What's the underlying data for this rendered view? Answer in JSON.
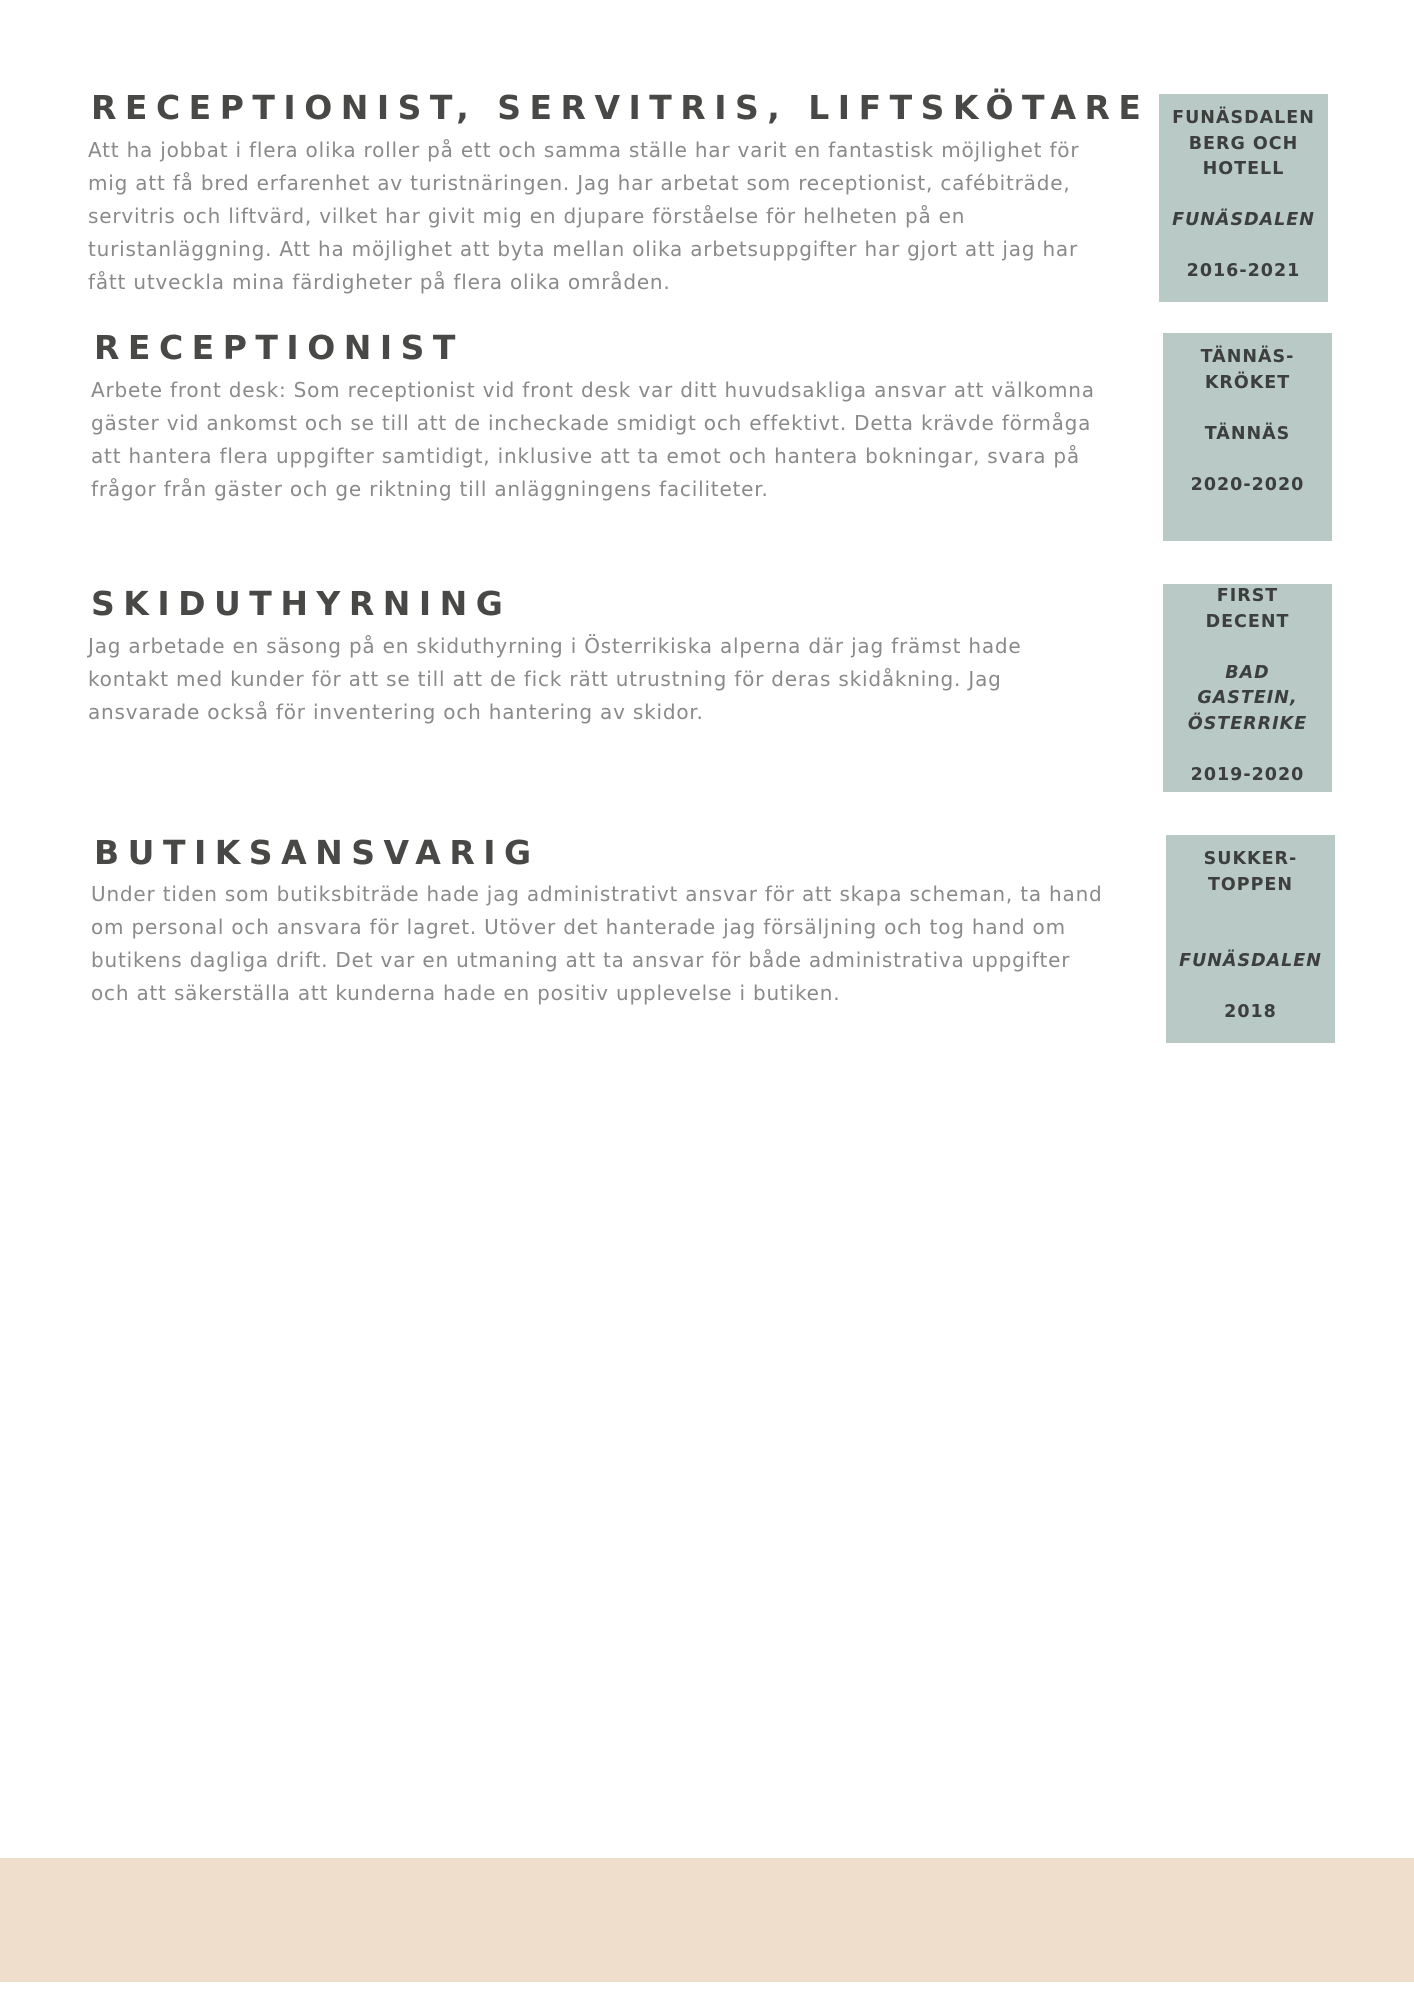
{
  "jobs": [
    {
      "title": "RECEPTIONIST, SERVITRIS, LIFTSKÖTARE",
      "description": "Att ha jobbat i flera olika roller på ett och samma ställe har varit en fantastisk möjlighet för mig att få bred erfarenhet av turistnäringen. Jag har arbetat som receptionist, cafébiträde, servitris och liftvärd, vilket har givit mig en djupare förståelse för helheten på en turistanläggning. Att ha möjlighet att byta mellan olika arbetsuppgifter har gjort att jag har fått utveckla mina färdigheter på flera olika områden.",
      "employer_lines": [
        "FUNÄSDALEN",
        "BERG OCH",
        "HOTELL"
      ],
      "location_lines": [
        "FUNÄSDALEN"
      ],
      "period": "2016-2021"
    },
    {
      "title": "RECEPTIONIST",
      "description": "Arbete front desk: Som receptionist vid front desk var ditt huvudsakliga ansvar att välkomna gäster vid ankomst och se till att de incheckade smidigt och effektivt. Detta krävde förmåga att hantera flera uppgifter samtidigt, inklusive att ta emot och hantera bokningar, svara på frågor från gäster och ge riktning till anläggningens faciliteter.",
      "employer_lines": [
        "TÄNNÄS-",
        "KRÖKET"
      ],
      "location_lines": [
        "TÄNNÄS"
      ],
      "period": "2020-2020"
    },
    {
      "title": "SKIDUTHYRNING",
      "description": "Jag arbetade en säsong på en skiduthyrning i Österrikiska alperna där jag främst hade kontakt med kunder för att se till att de fick rätt utrustning för deras skidåkning. Jag ansvarade också för inventering och hantering av skidor.",
      "employer_lines": [
        "FIRST",
        "DECENT"
      ],
      "location_lines": [
        "BAD",
        "GASTEIN,",
        "ÖSTERRIKE"
      ],
      "period": "2019-2020"
    },
    {
      "title": "BUTIKSANSVARIG",
      "description": "Under tiden som butiksbiträde hade jag administrativt ansvar för att skapa scheman, ta hand om personal och ansvara för lagret. Utöver det hanterade jag försäljning och tog hand om butikens dagliga drift. Det var en utmaning att ta ansvar för både administrativa uppgifter och att säkerställa att kunderna hade en positiv upplevelse i butiken.",
      "employer_lines": [
        "SUKKER-",
        "TOPPEN"
      ],
      "location_lines": [
        "FUNÄSDALEN"
      ],
      "period": "2018"
    }
  ]
}
